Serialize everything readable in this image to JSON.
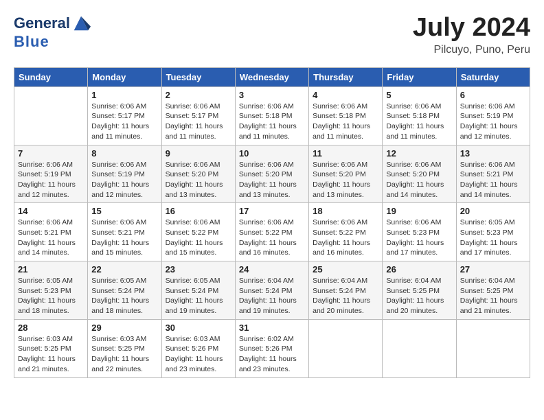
{
  "header": {
    "logo_line1": "General",
    "logo_line2": "Blue",
    "month": "July 2024",
    "location": "Pilcuyo, Puno, Peru"
  },
  "weekdays": [
    "Sunday",
    "Monday",
    "Tuesday",
    "Wednesday",
    "Thursday",
    "Friday",
    "Saturday"
  ],
  "weeks": [
    [
      {
        "day": "",
        "info": ""
      },
      {
        "day": "1",
        "info": "Sunrise: 6:06 AM\nSunset: 5:17 PM\nDaylight: 11 hours\nand 11 minutes."
      },
      {
        "day": "2",
        "info": "Sunrise: 6:06 AM\nSunset: 5:17 PM\nDaylight: 11 hours\nand 11 minutes."
      },
      {
        "day": "3",
        "info": "Sunrise: 6:06 AM\nSunset: 5:18 PM\nDaylight: 11 hours\nand 11 minutes."
      },
      {
        "day": "4",
        "info": "Sunrise: 6:06 AM\nSunset: 5:18 PM\nDaylight: 11 hours\nand 11 minutes."
      },
      {
        "day": "5",
        "info": "Sunrise: 6:06 AM\nSunset: 5:18 PM\nDaylight: 11 hours\nand 11 minutes."
      },
      {
        "day": "6",
        "info": "Sunrise: 6:06 AM\nSunset: 5:19 PM\nDaylight: 11 hours\nand 12 minutes."
      }
    ],
    [
      {
        "day": "7",
        "info": ""
      },
      {
        "day": "8",
        "info": "Sunrise: 6:06 AM\nSunset: 5:19 PM\nDaylight: 11 hours\nand 12 minutes."
      },
      {
        "day": "9",
        "info": "Sunrise: 6:06 AM\nSunset: 5:20 PM\nDaylight: 11 hours\nand 13 minutes."
      },
      {
        "day": "10",
        "info": "Sunrise: 6:06 AM\nSunset: 5:20 PM\nDaylight: 11 hours\nand 13 minutes."
      },
      {
        "day": "11",
        "info": "Sunrise: 6:06 AM\nSunset: 5:20 PM\nDaylight: 11 hours\nand 13 minutes."
      },
      {
        "day": "12",
        "info": "Sunrise: 6:06 AM\nSunset: 5:20 PM\nDaylight: 11 hours\nand 14 minutes."
      },
      {
        "day": "13",
        "info": "Sunrise: 6:06 AM\nSunset: 5:21 PM\nDaylight: 11 hours\nand 14 minutes."
      }
    ],
    [
      {
        "day": "14",
        "info": ""
      },
      {
        "day": "15",
        "info": "Sunrise: 6:06 AM\nSunset: 5:21 PM\nDaylight: 11 hours\nand 15 minutes."
      },
      {
        "day": "16",
        "info": "Sunrise: 6:06 AM\nSunset: 5:22 PM\nDaylight: 11 hours\nand 15 minutes."
      },
      {
        "day": "17",
        "info": "Sunrise: 6:06 AM\nSunset: 5:22 PM\nDaylight: 11 hours\nand 16 minutes."
      },
      {
        "day": "18",
        "info": "Sunrise: 6:06 AM\nSunset: 5:22 PM\nDaylight: 11 hours\nand 16 minutes."
      },
      {
        "day": "19",
        "info": "Sunrise: 6:06 AM\nSunset: 5:23 PM\nDaylight: 11 hours\nand 17 minutes."
      },
      {
        "day": "20",
        "info": "Sunrise: 6:05 AM\nSunset: 5:23 PM\nDaylight: 11 hours\nand 17 minutes."
      }
    ],
    [
      {
        "day": "21",
        "info": ""
      },
      {
        "day": "22",
        "info": "Sunrise: 6:05 AM\nSunset: 5:24 PM\nDaylight: 11 hours\nand 18 minutes."
      },
      {
        "day": "23",
        "info": "Sunrise: 6:05 AM\nSunset: 5:24 PM\nDaylight: 11 hours\nand 19 minutes."
      },
      {
        "day": "24",
        "info": "Sunrise: 6:04 AM\nSunset: 5:24 PM\nDaylight: 11 hours\nand 19 minutes."
      },
      {
        "day": "25",
        "info": "Sunrise: 6:04 AM\nSunset: 5:24 PM\nDaylight: 11 hours\nand 20 minutes."
      },
      {
        "day": "26",
        "info": "Sunrise: 6:04 AM\nSunset: 5:25 PM\nDaylight: 11 hours\nand 20 minutes."
      },
      {
        "day": "27",
        "info": "Sunrise: 6:04 AM\nSunset: 5:25 PM\nDaylight: 11 hours\nand 21 minutes."
      }
    ],
    [
      {
        "day": "28",
        "info": ""
      },
      {
        "day": "29",
        "info": "Sunrise: 6:03 AM\nSunset: 5:25 PM\nDaylight: 11 hours\nand 22 minutes."
      },
      {
        "day": "30",
        "info": "Sunrise: 6:03 AM\nSunset: 5:26 PM\nDaylight: 11 hours\nand 23 minutes."
      },
      {
        "day": "31",
        "info": "Sunrise: 6:02 AM\nSunset: 5:26 PM\nDaylight: 11 hours\nand 23 minutes."
      },
      {
        "day": "",
        "info": ""
      },
      {
        "day": "",
        "info": ""
      },
      {
        "day": "",
        "info": ""
      }
    ]
  ],
  "week1_day7_info": "Sunrise: 6:06 AM\nSunset: 5:19 PM\nDaylight: 11 hours\nand 12 minutes.",
  "week2_day14_info": "Sunrise: 6:06 AM\nSunset: 5:21 PM\nDaylight: 11 hours\nand 14 minutes.",
  "week3_day21_info": "Sunrise: 6:05 AM\nSunset: 5:23 PM\nDaylight: 11 hours\nand 18 minutes.",
  "week4_day28_info": "Sunrise: 6:03 AM\nSunset: 5:25 PM\nDaylight: 11 hours\nand 21 minutes."
}
